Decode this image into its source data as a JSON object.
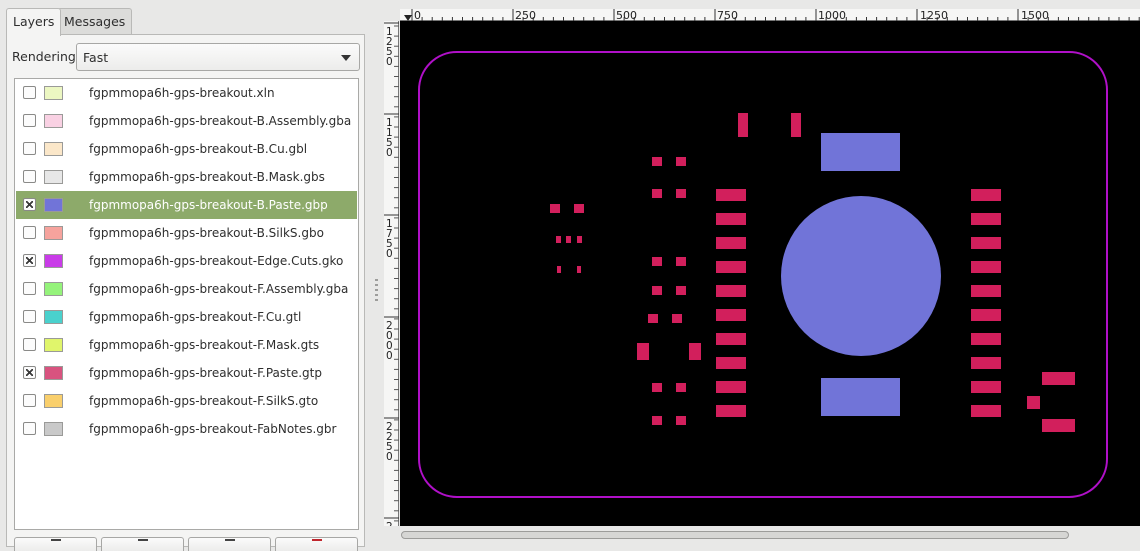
{
  "tabs": [
    {
      "label": "Layers",
      "active": true
    },
    {
      "label": "Messages",
      "active": false
    }
  ],
  "rendering": {
    "label": "Rendering:",
    "value": "Fast"
  },
  "layers": [
    {
      "name": "fgpmmopa6h-gps-breakout.xln",
      "visible": false,
      "color": "#ecf7c2",
      "selected": false
    },
    {
      "name": "fgpmmopa6h-gps-breakout-B.Assembly.gba",
      "visible": false,
      "color": "#f9d1e3",
      "selected": false
    },
    {
      "name": "fgpmmopa6h-gps-breakout-B.Cu.gbl",
      "visible": false,
      "color": "#fbe7c9",
      "selected": false
    },
    {
      "name": "fgpmmopa6h-gps-breakout-B.Mask.gbs",
      "visible": false,
      "color": "#e7e7e7",
      "selected": false
    },
    {
      "name": "fgpmmopa6h-gps-breakout-B.Paste.gbp",
      "visible": true,
      "color": "#7174d8",
      "selected": true
    },
    {
      "name": "fgpmmopa6h-gps-breakout-B.SilkS.gbo",
      "visible": false,
      "color": "#f6a39d",
      "selected": false
    },
    {
      "name": "fgpmmopa6h-gps-breakout-Edge.Cuts.gko",
      "visible": true,
      "color": "#c93ce8",
      "selected": false
    },
    {
      "name": "fgpmmopa6h-gps-breakout-F.Assembly.gba",
      "visible": false,
      "color": "#95f37b",
      "selected": false
    },
    {
      "name": "fgpmmopa6h-gps-breakout-F.Cu.gtl",
      "visible": false,
      "color": "#4ad1cd",
      "selected": false
    },
    {
      "name": "fgpmmopa6h-gps-breakout-F.Mask.gts",
      "visible": false,
      "color": "#e0f56b",
      "selected": false
    },
    {
      "name": "fgpmmopa6h-gps-breakout-F.Paste.gtp",
      "visible": true,
      "color": "#d8537f",
      "selected": false
    },
    {
      "name": "fgpmmopa6h-gps-breakout-F.SilkS.gto",
      "visible": false,
      "color": "#f9cf6c",
      "selected": false
    },
    {
      "name": "fgpmmopa6h-gps-breakout-FabNotes.gbr",
      "visible": false,
      "color": "#c9c9c9",
      "selected": false
    }
  ],
  "ruler": {
    "h_ticks": [
      "0",
      "250",
      "500",
      "750",
      "1000",
      "1250",
      "1500"
    ],
    "v_groups": [
      [
        "1",
        "2",
        "5",
        "0"
      ],
      [
        "1",
        "1",
        "5",
        "0"
      ],
      [
        "1",
        "7",
        "5",
        "0"
      ],
      [
        "2",
        "0",
        "0",
        "0"
      ],
      [
        "2",
        "2",
        "5",
        "0"
      ],
      [
        "2"
      ]
    ]
  },
  "colors": {
    "canvas_bg": "#000000",
    "front_paste": "#d21f5c",
    "back_paste": "#7174d8",
    "edge_cuts": "#b010c8"
  }
}
